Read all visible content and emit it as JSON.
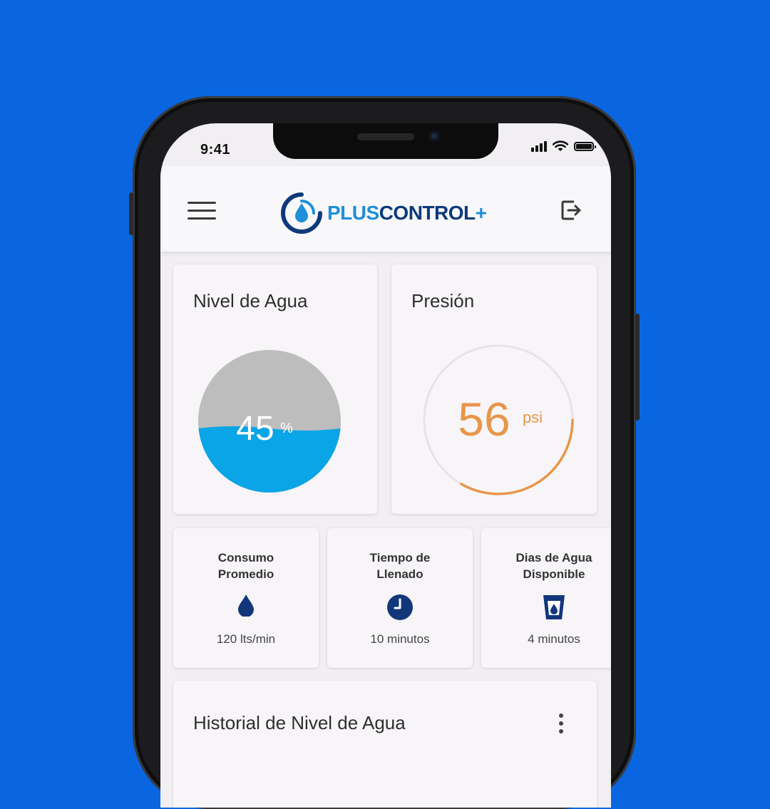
{
  "status": {
    "time": "9:41"
  },
  "header": {
    "logo_plus_word": "PLUS",
    "logo_control_word": "CONTROL",
    "logo_plus_sign": "+"
  },
  "water_level": {
    "title": "Nivel de Agua",
    "value": "45",
    "unit": "%",
    "fill_fraction": 0.45
  },
  "pressure": {
    "title": "Presión",
    "value": "56",
    "unit": "psi",
    "accent_color": "#e8964a"
  },
  "stats": [
    {
      "label": "Consumo\nPromedio",
      "icon": "water-drop-icon",
      "value": "120 lts/min"
    },
    {
      "label": "Tiempo de\nLlenado",
      "icon": "clock-icon",
      "value": "10 minutos"
    },
    {
      "label": "Dias de Agua\nDisponible",
      "icon": "water-glass-icon",
      "value": "4 minutos"
    }
  ],
  "history": {
    "title": "Historial de Nivel de Agua"
  },
  "colors": {
    "background": "#0a66e0",
    "water": "#0aa5e6",
    "brand_light": "#1e8fd8",
    "brand_dark": "#0d3a7a",
    "icon_navy": "#11367a"
  }
}
